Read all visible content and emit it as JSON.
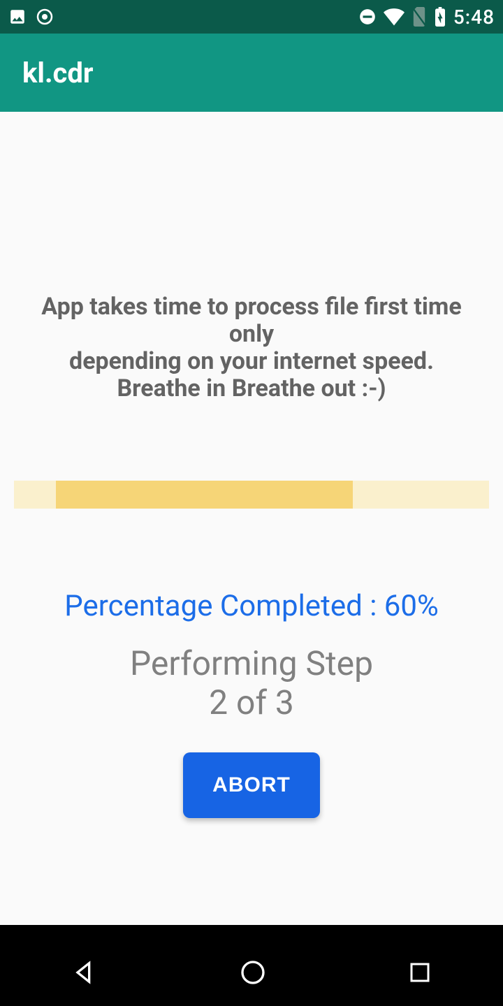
{
  "status_bar": {
    "time": "5:48"
  },
  "app_bar": {
    "title": "kl.cdr"
  },
  "content": {
    "info_line1": "App takes time to process file first time only",
    "info_line2": "depending on your internet speed.",
    "info_line3": "Breathe in Breathe out :-)",
    "percentage_label": "Percentage Completed : 60%",
    "percentage_value": 60,
    "step_line1": "Performing Step",
    "step_line2": "2 of 3",
    "current_step": 2,
    "total_steps": 3,
    "abort_label": "ABORT"
  }
}
